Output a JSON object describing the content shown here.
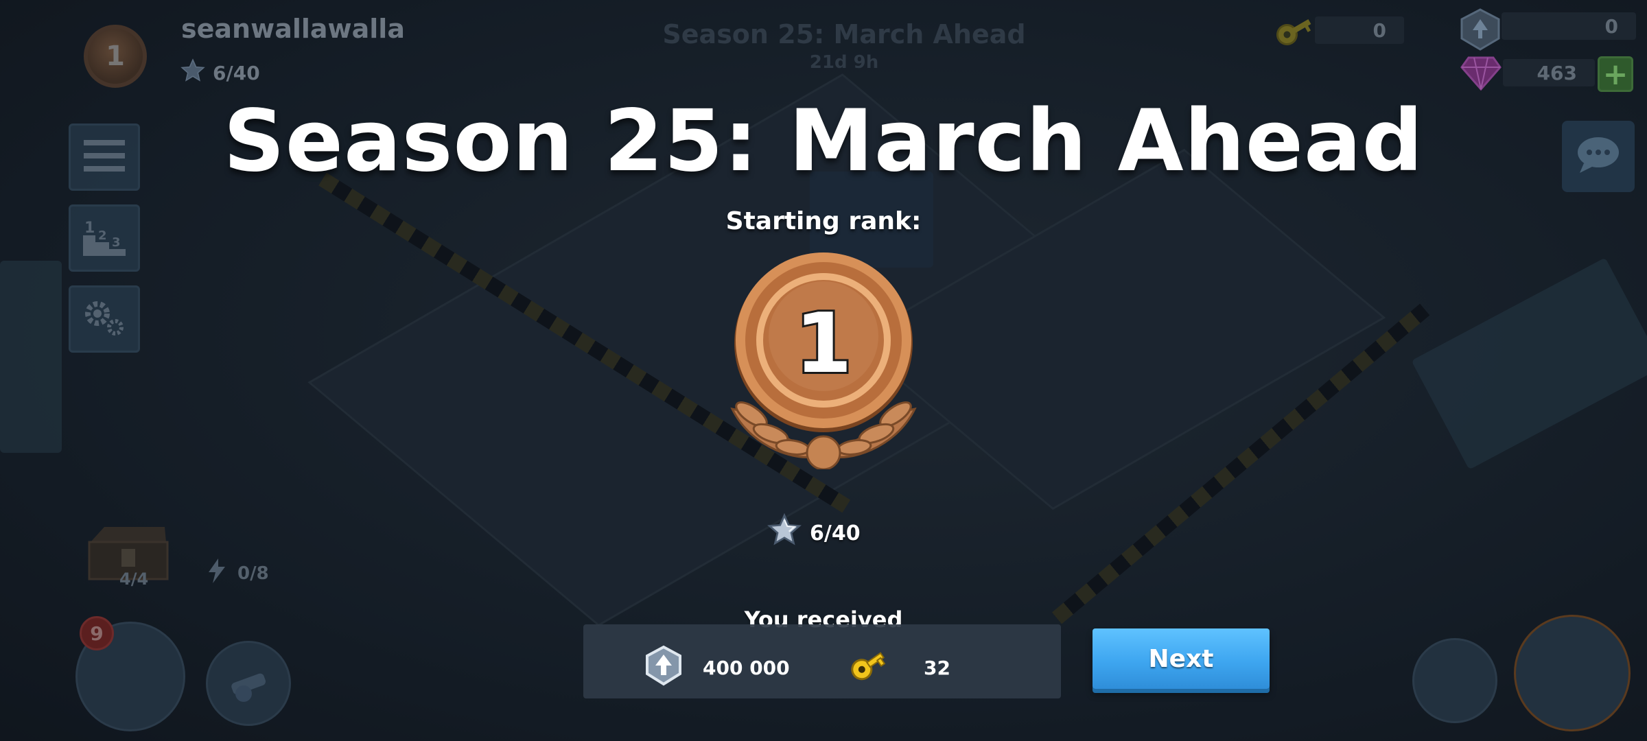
{
  "hud": {
    "rank_badge": "1",
    "player_name": "seanwallawalla",
    "stars": "6/40",
    "faint_season_title": "Season 25: March Ahead",
    "faint_timer": "21d 9h",
    "chest_count": "4/4",
    "bolts": "0/8",
    "notification_badge": "9",
    "resources": {
      "keys": "0",
      "tokens": "0",
      "diamonds": "463"
    },
    "plus_label": "+"
  },
  "modal": {
    "title": "Season 25: March Ahead",
    "starting_rank_label": "Starting rank:",
    "rank_number": "1",
    "stars": "6/40",
    "received_label": "You received",
    "rewards": [
      {
        "icon": "token-icon",
        "amount": "400 000"
      },
      {
        "icon": "key-icon",
        "amount": "32"
      }
    ],
    "next_label": "Next"
  },
  "colors": {
    "bronze": "#c07a4a",
    "next_button": "#3ea6f0",
    "key_gold": "#f2c51c",
    "star_silver": "#b9c6d6"
  }
}
